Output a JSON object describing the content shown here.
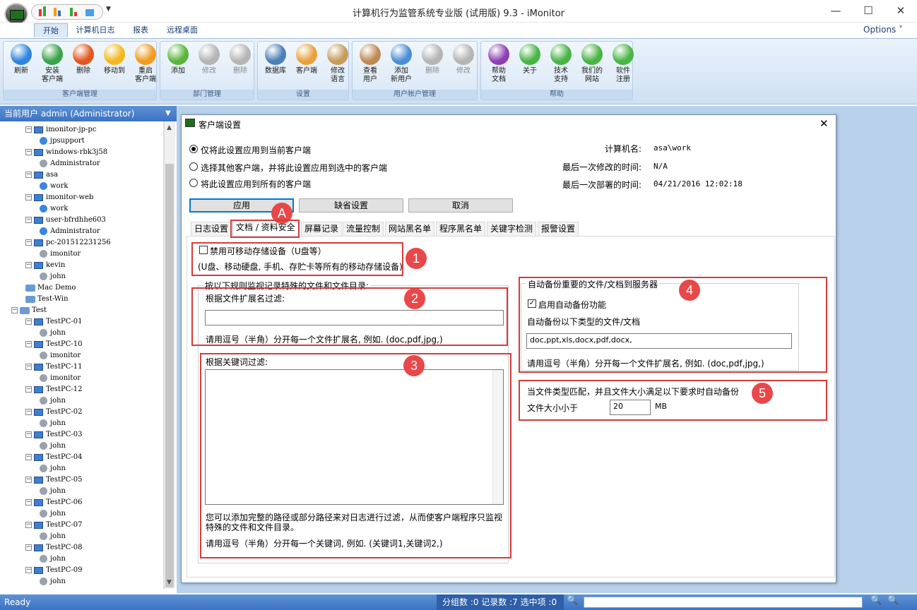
{
  "window": {
    "title": "计算机行为监管系统专业版 (试用版) 9.3 - iMonitor",
    "min": "—",
    "max": "☐",
    "close": "✕"
  },
  "menu": {
    "tabs": [
      "开始",
      "计算机日志",
      "报表",
      "远程桌面"
    ],
    "options": "Options ˅"
  },
  "ribbon": {
    "groups": [
      {
        "label": "客户端管理",
        "buttons": [
          {
            "label": "刷新",
            "icon": "refresh-icon",
            "color": "#2e86de",
            "enabled": true
          },
          {
            "label": "安装\n客户端",
            "icon": "install-client-icon",
            "color": "#3aa34a",
            "enabled": true
          },
          {
            "label": "删除",
            "icon": "delete-icon",
            "color": "#e2571e",
            "enabled": true
          },
          {
            "label": "移动到",
            "icon": "move-icon",
            "color": "#f2b81e",
            "enabled": true
          },
          {
            "label": "重启\n客户端",
            "icon": "restart-icon",
            "color": "#f29b1e",
            "enabled": true
          }
        ]
      },
      {
        "label": "部门管理",
        "buttons": [
          {
            "label": "添加",
            "icon": "add-icon",
            "color": "#5ab63a",
            "enabled": true
          },
          {
            "label": "修改",
            "icon": "edit-icon",
            "color": "#b5b5b5",
            "enabled": false
          },
          {
            "label": "删除",
            "icon": "delete-icon",
            "color": "#b5b5b5",
            "enabled": false
          }
        ]
      },
      {
        "label": "设置",
        "buttons": [
          {
            "label": "数据库",
            "icon": "database-icon",
            "color": "#4a7fb8",
            "enabled": true
          },
          {
            "label": "客户端",
            "icon": "client-settings-icon",
            "color": "#e8a23c",
            "enabled": true
          },
          {
            "label": "修改\n语言",
            "icon": "language-icon",
            "color": "#c79b5a",
            "enabled": true
          }
        ]
      },
      {
        "label": "用户帐户管理",
        "buttons": [
          {
            "label": "查看\n用户",
            "icon": "view-users-icon",
            "color": "#c08a55",
            "enabled": true
          },
          {
            "label": "添加\n新用户",
            "icon": "add-user-icon",
            "color": "#4a8fd6",
            "enabled": true
          },
          {
            "label": "删除",
            "icon": "delete-user-icon",
            "color": "#b5b5b5",
            "enabled": false
          },
          {
            "label": "修改",
            "icon": "edit-user-icon",
            "color": "#b5b5b5",
            "enabled": false
          }
        ]
      },
      {
        "label": "帮助",
        "buttons": [
          {
            "label": "帮助\n文档",
            "icon": "help-icon",
            "color": "#8e3fb5",
            "enabled": true
          },
          {
            "label": "关于",
            "icon": "about-icon",
            "color": "#49b545",
            "enabled": true
          },
          {
            "label": "技术\n支持",
            "icon": "support-icon",
            "color": "#49b545",
            "enabled": true
          },
          {
            "label": "我们的\n网站",
            "icon": "home-icon",
            "color": "#49b545",
            "enabled": true
          },
          {
            "label": "软件\n注册",
            "icon": "cart-icon",
            "color": "#49b545",
            "enabled": true
          }
        ]
      }
    ]
  },
  "sidebar": {
    "header": "当前用户 admin (Administrator)",
    "tree": [
      {
        "t": "imonitor-jp-pc",
        "k": "pc",
        "l": 2
      },
      {
        "t": "jpsupport",
        "k": "user",
        "l": 3
      },
      {
        "t": "windows-rbk3j58",
        "k": "pc",
        "l": 2
      },
      {
        "t": "Administrator",
        "k": "guser",
        "l": 3
      },
      {
        "t": "asa",
        "k": "pc",
        "l": 2
      },
      {
        "t": "work",
        "k": "user",
        "l": 3
      },
      {
        "t": "imonitor-web",
        "k": "pc",
        "l": 2
      },
      {
        "t": "work",
        "k": "user",
        "l": 3
      },
      {
        "t": "user-bfrdhhe603",
        "k": "pc",
        "l": 2
      },
      {
        "t": "Administrator",
        "k": "user",
        "l": 3
      },
      {
        "t": "pc-201512231256",
        "k": "pc",
        "l": 2
      },
      {
        "t": "imonitor",
        "k": "guser",
        "l": 3
      },
      {
        "t": "kevin",
        "k": "pc",
        "l": 2
      },
      {
        "t": "john",
        "k": "guser",
        "l": 3
      },
      {
        "t": "Mac Demo",
        "k": "group",
        "l": 1
      },
      {
        "t": "Test-Win",
        "k": "group",
        "l": 1
      },
      {
        "t": "Test",
        "k": "group",
        "l": 0
      },
      {
        "t": "TestPC-01",
        "k": "pc",
        "l": 2
      },
      {
        "t": "john",
        "k": "guser",
        "l": 3
      },
      {
        "t": "TestPC-10",
        "k": "pc",
        "l": 2
      },
      {
        "t": "imonitor",
        "k": "guser",
        "l": 3
      },
      {
        "t": "TestPC-11",
        "k": "pc",
        "l": 2
      },
      {
        "t": "imonitor",
        "k": "guser",
        "l": 3
      },
      {
        "t": "TestPC-12",
        "k": "pc",
        "l": 2
      },
      {
        "t": "john",
        "k": "guser",
        "l": 3
      },
      {
        "t": "TestPC-02",
        "k": "pc",
        "l": 2
      },
      {
        "t": "john",
        "k": "guser",
        "l": 3
      },
      {
        "t": "TestPC-03",
        "k": "pc",
        "l": 2
      },
      {
        "t": "john",
        "k": "guser",
        "l": 3
      },
      {
        "t": "TestPC-04",
        "k": "pc",
        "l": 2
      },
      {
        "t": "john",
        "k": "guser",
        "l": 3
      },
      {
        "t": "TestPC-05",
        "k": "pc",
        "l": 2
      },
      {
        "t": "john",
        "k": "guser",
        "l": 3
      },
      {
        "t": "TestPC-06",
        "k": "pc",
        "l": 2
      },
      {
        "t": "john",
        "k": "guser",
        "l": 3
      },
      {
        "t": "TestPC-07",
        "k": "pc",
        "l": 2
      },
      {
        "t": "john",
        "k": "guser",
        "l": 3
      },
      {
        "t": "TestPC-08",
        "k": "pc",
        "l": 2
      },
      {
        "t": "john",
        "k": "guser",
        "l": 3
      },
      {
        "t": "TestPC-09",
        "k": "pc",
        "l": 2
      },
      {
        "t": "john",
        "k": "guser",
        "l": 3
      }
    ]
  },
  "dialog": {
    "title": "客户端设置",
    "radio_current": "仅将此设置应用到当前客户端",
    "radio_selected": "选择其他客户端，并将此设置应用到选中的客户端",
    "radio_all": "将此设置应用到所有的客户端",
    "computer_name_label": "计算机名:",
    "computer_name": "asa\\work",
    "last_modified_label": "最后一次修改的时间:",
    "last_modified": "N/A",
    "last_deployed_label": "最后一次部署的时间:",
    "last_deployed": "04/21/2016 12:02:18",
    "apply": "应用",
    "default": "缺省设置",
    "cancel": "取消",
    "tabs": [
      "日志设置",
      "文档 / 资料安全",
      "屏幕记录",
      "流量控制",
      "网站黑名单",
      "程序黑名单",
      "关键字检测",
      "报警设置"
    ],
    "usb_disable": "禁用可移动存储设备（U盘等）",
    "usb_desc": "(U盘、移动硬盘, 手机、存贮卡等所有的移动存储设备)",
    "monitor_group": "按以下规则监视记录特殊的文件和文件目录:",
    "ext_filter_label": "根据文件扩展名过滤:",
    "ext_filter_value": "",
    "ext_hint": "请用逗号（半角）分开每一个文件扩展名, 例如. (doc,pdf,jpg,)",
    "kw_filter_label": "根据关键词过滤:",
    "kw_note": "您可以添加完整的路径或部分路径来对日志进行过滤，从而使客户端程序只监视\n特殊的文件和文件目录。",
    "kw_hint": "请用逗号（半角）分开每一个关键词, 例如. (关键词1,关键词2,)",
    "backup_group": "自动备份重要的文件/文档到服务器",
    "backup_enable": "启用自动备份功能",
    "backup_types_label": "自动备份以下类型的文件/文档",
    "backup_types_value": "doc,ppt,xls,docx,pdf,docx,",
    "backup_hint": "请用逗号（半角）分开每一个文件扩展名, 例如. (doc,pdf,jpg,)",
    "size_rule": "当文件类型匹配，并且文件大小满足以下要求时自动备份",
    "size_label": "文件大小小于",
    "size_value": "20",
    "size_unit": "MB"
  },
  "annotations": {
    "a": "A",
    "n1": "1",
    "n2": "2",
    "n3": "3",
    "n4": "4",
    "n5": "5"
  },
  "status": {
    "ready": "Ready",
    "stats": "分组数 :0  记录数 :7  选中项 :0"
  }
}
